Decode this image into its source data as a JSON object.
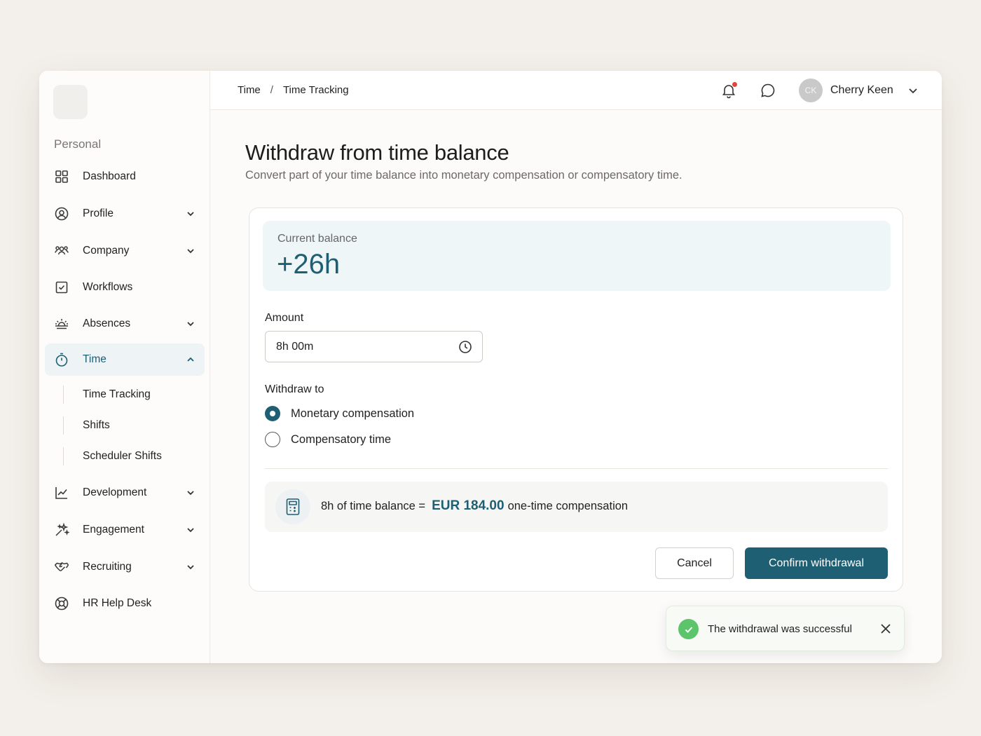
{
  "sidebar": {
    "section_label": "Personal",
    "items": [
      {
        "label": "Dashboard",
        "icon": "grid-icon"
      },
      {
        "label": "Profile",
        "icon": "user-circle-icon"
      },
      {
        "label": "Company",
        "icon": "users-icon"
      },
      {
        "label": "Workflows",
        "icon": "checkbox-icon"
      },
      {
        "label": "Absences",
        "icon": "sunrise-icon"
      },
      {
        "label": "Time",
        "icon": "stopwatch-icon",
        "active": true
      },
      {
        "label": "Development",
        "icon": "chart-line-icon"
      },
      {
        "label": "Engagement",
        "icon": "sparkle-icon"
      },
      {
        "label": "Recruiting",
        "icon": "handshake-icon"
      },
      {
        "label": "HR Help Desk",
        "icon": "lifebuoy-icon"
      }
    ],
    "sub_items": [
      {
        "label": "Time Tracking"
      },
      {
        "label": "Shifts"
      },
      {
        "label": "Scheduler Shifts"
      }
    ]
  },
  "breadcrumb": {
    "parent": "Time",
    "separator": "/",
    "current": "Time Tracking"
  },
  "user": {
    "initials": "CK",
    "name": "Cherry Keen"
  },
  "page": {
    "title": "Withdraw from time balance",
    "subtitle": "Convert part of your time balance into monetary compensation or compensatory time."
  },
  "balance": {
    "caption": "Current balance",
    "value": "+26h"
  },
  "amount": {
    "label": "Amount",
    "value": "8h 00m"
  },
  "withdraw_to": {
    "label": "Withdraw to",
    "options": [
      {
        "label": "Monetary compensation",
        "selected": true
      },
      {
        "label": "Compensatory time",
        "selected": false
      }
    ]
  },
  "summary": {
    "prefix": "8h of time balance =",
    "amount": "EUR 184.00",
    "suffix": "one-time compensation"
  },
  "actions": {
    "cancel": "Cancel",
    "confirm": "Confirm withdrawal"
  },
  "toast": {
    "message": "The withdrawal was successful"
  },
  "colors": {
    "accent": "#1e5f74",
    "success": "#5cc46a",
    "notification": "#e2453c",
    "background": "#f3efea"
  }
}
